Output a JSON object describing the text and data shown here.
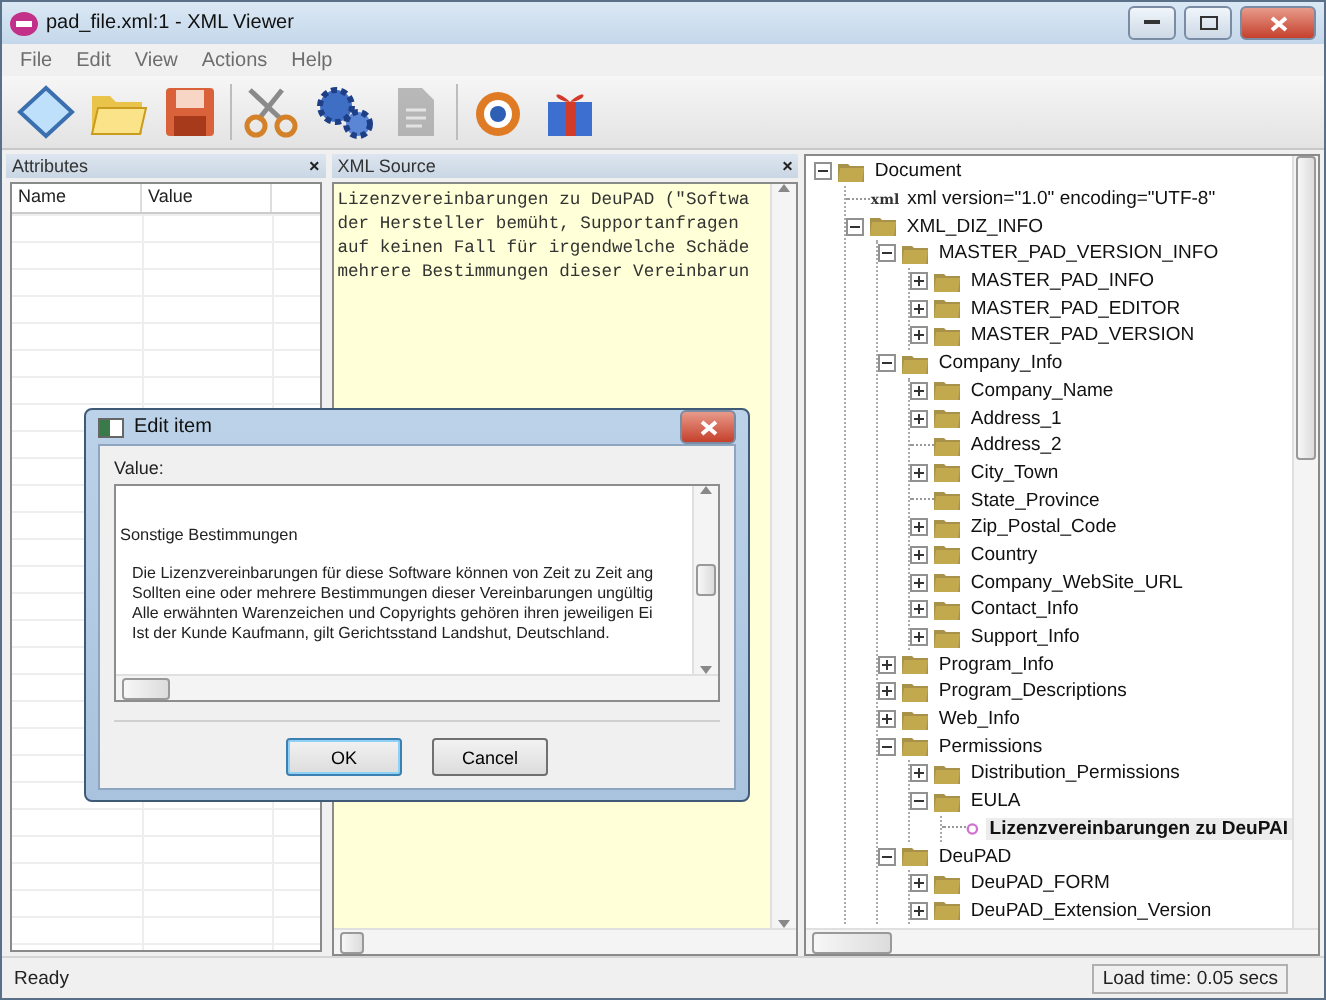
{
  "window": {
    "title": "pad_file.xml:1 - XML Viewer"
  },
  "menu": [
    "File",
    "Edit",
    "View",
    "Actions",
    "Help"
  ],
  "toolbar": [
    {
      "kind": "notebook",
      "disabled": false
    },
    {
      "kind": "folder",
      "disabled": false
    },
    {
      "kind": "floppy",
      "disabled": false
    },
    {
      "kind": "scissors",
      "disabled": false
    },
    {
      "kind": "gears",
      "disabled": false
    },
    {
      "kind": "document",
      "disabled": true
    },
    {
      "kind": "target",
      "disabled": false
    },
    {
      "kind": "gift",
      "disabled": false
    }
  ],
  "attributes_panel": {
    "title": "Attributes",
    "close": "×",
    "columns": [
      "Name",
      "Value"
    ]
  },
  "source_panel": {
    "title": "XML Source",
    "close": "×",
    "lines": [
      "Lizenzvereinbarungen zu DeuPAD (\"Softwa",
      "der Hersteller bemüht, Supportanfragen",
      "auf keinen Fall für irgendwelche Schäde",
      "mehrere Bestimmungen dieser Vereinbarun"
    ]
  },
  "tree": [
    {
      "kind": "folder",
      "label": "Document",
      "expanded": true,
      "selected": false,
      "children": [
        {
          "kind": "declaration",
          "badge": "xml",
          "label": "xml version=\"1.0\" encoding=\"UTF-8\"",
          "selected": false
        },
        {
          "kind": "folder",
          "label": "XML_DIZ_INFO",
          "expanded": true,
          "selected": false,
          "children": [
            {
              "kind": "folder",
              "label": "MASTER_PAD_VERSION_INFO",
              "expanded": true,
              "selected": false,
              "children": [
                {
                  "kind": "folder",
                  "label": "MASTER_PAD_INFO",
                  "expanded": false,
                  "selected": false
                },
                {
                  "kind": "folder",
                  "label": "MASTER_PAD_EDITOR",
                  "expanded": false,
                  "selected": false
                },
                {
                  "kind": "folder",
                  "label": "MASTER_PAD_VERSION",
                  "expanded": false,
                  "selected": false
                }
              ]
            },
            {
              "kind": "folder",
              "label": "Company_Info",
              "expanded": true,
              "selected": false,
              "children": [
                {
                  "kind": "folder",
                  "label": "Company_Name",
                  "expanded": false,
                  "selected": false
                },
                {
                  "kind": "folder",
                  "label": "Address_1",
                  "expanded": false,
                  "selected": false
                },
                {
                  "kind": "leaf",
                  "label": "Address_2",
                  "selected": false
                },
                {
                  "kind": "folder",
                  "label": "City_Town",
                  "expanded": false,
                  "selected": false
                },
                {
                  "kind": "leaf",
                  "label": "State_Province",
                  "selected": false
                },
                {
                  "kind": "folder",
                  "label": "Zip_Postal_Code",
                  "expanded": false,
                  "selected": false
                },
                {
                  "kind": "folder",
                  "label": "Country",
                  "expanded": false,
                  "selected": false
                },
                {
                  "kind": "folder",
                  "label": "Company_WebSite_URL",
                  "expanded": false,
                  "selected": false
                },
                {
                  "kind": "folder",
                  "label": "Contact_Info",
                  "expanded": false,
                  "selected": false
                },
                {
                  "kind": "folder",
                  "label": "Support_Info",
                  "expanded": false,
                  "selected": false
                }
              ]
            },
            {
              "kind": "folder",
              "label": "Program_Info",
              "expanded": false,
              "selected": false
            },
            {
              "kind": "folder",
              "label": "Program_Descriptions",
              "expanded": false,
              "selected": false
            },
            {
              "kind": "folder",
              "label": "Web_Info",
              "expanded": false,
              "selected": false
            },
            {
              "kind": "folder",
              "label": "Permissions",
              "expanded": true,
              "selected": false,
              "children": [
                {
                  "kind": "folder",
                  "label": "Distribution_Permissions",
                  "expanded": false,
                  "selected": false
                },
                {
                  "kind": "folder",
                  "label": "EULA",
                  "expanded": true,
                  "selected": false,
                  "children": [
                    {
                      "kind": "value",
                      "label": "Lizenzvereinbarungen zu DeuPAI",
                      "selected": true
                    }
                  ]
                }
              ]
            },
            {
              "kind": "folder",
              "label": "DeuPAD",
              "expanded": true,
              "selected": false,
              "children": [
                {
                  "kind": "folder",
                  "label": "DeuPAD_FORM",
                  "expanded": false,
                  "selected": false
                },
                {
                  "kind": "folder",
                  "label": "DeuPAD_Extension_Version",
                  "expanded": false,
                  "selected": false
                }
              ]
            }
          ]
        }
      ]
    }
  ],
  "dialog": {
    "title": "Edit item",
    "label": "Value:",
    "heading": "Sonstige Bestimmungen",
    "paragraph": [
      "Die Lizenzvereinbarungen für diese Software können von Zeit zu Zeit ang",
      "Sollten eine oder mehrere Bestimmungen dieser Vereinbarungen ungültig",
      "Alle erwähnten Warenzeichen und Copyrights gehören ihren jeweiligen Ei",
      "Ist der Kunde Kaufmann, gilt Gerichtsstand Landshut, Deutschland."
    ],
    "buttons": [
      {
        "label": "OK",
        "default": true
      },
      {
        "label": "Cancel",
        "default": false
      }
    ]
  },
  "status_bar": {
    "message": "Ready",
    "load_time": "Load time: 0.05 secs"
  }
}
